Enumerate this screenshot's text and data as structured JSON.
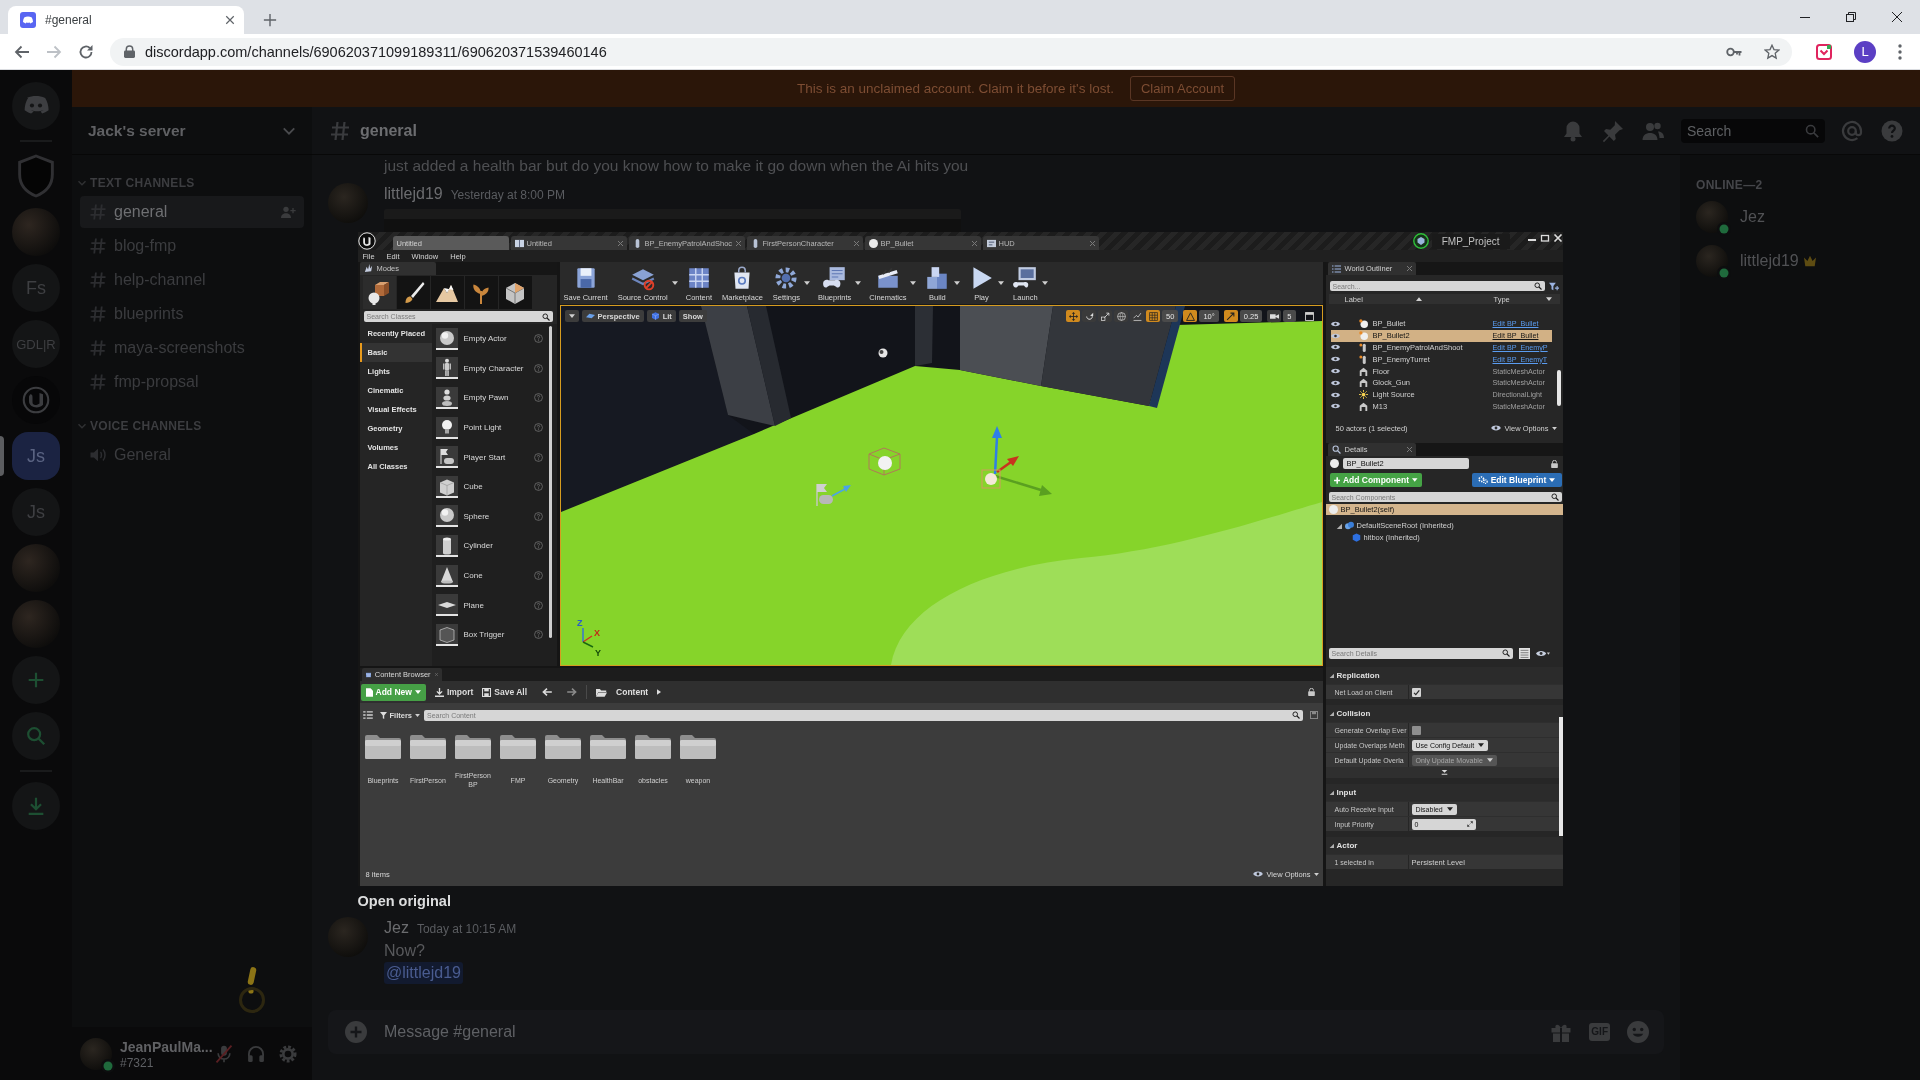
{
  "browser": {
    "tab_title": "#general",
    "url": "discordapp.com/channels/690620371099189311/690620371539460146",
    "profile_initial": "L"
  },
  "discord": {
    "banner": {
      "text": "This is an unclaimed account. Claim it before it's lost.",
      "button": "Claim Account"
    },
    "servers": [
      {
        "kind": "home",
        "selected": false
      },
      {
        "kind": "shield",
        "selected": false
      },
      {
        "kind": "photo",
        "selected": false
      },
      {
        "kind": "text",
        "label": "Fs",
        "selected": false
      },
      {
        "kind": "text",
        "label": "GDL|R",
        "selected": false
      },
      {
        "kind": "engine",
        "selected": false
      },
      {
        "kind": "text",
        "label": "Js",
        "selected": true
      },
      {
        "kind": "text",
        "label": "Js",
        "selected": false
      },
      {
        "kind": "photo",
        "selected": false
      },
      {
        "kind": "photo",
        "selected": false
      },
      {
        "kind": "add",
        "selected": false
      },
      {
        "kind": "explore",
        "selected": false
      },
      {
        "kind": "download",
        "selected": false
      }
    ],
    "server_name": "Jack's server",
    "channel_groups": [
      {
        "title": "TEXT CHANNELS",
        "kind": "text",
        "channels": [
          {
            "name": "general",
            "selected": true
          },
          {
            "name": "blog-fmp",
            "selected": false
          },
          {
            "name": "help-channel",
            "selected": false
          },
          {
            "name": "blueprints",
            "selected": false
          },
          {
            "name": "maya-screenshots",
            "selected": false
          },
          {
            "name": "fmp-propsal",
            "selected": false
          }
        ]
      },
      {
        "title": "VOICE CHANNELS",
        "kind": "voice",
        "channels": [
          {
            "name": "General",
            "selected": false
          }
        ]
      }
    ],
    "user": {
      "name": "JeanPaulMa...",
      "tag": "#7321",
      "mic_muted": true
    },
    "chat": {
      "channel": "general",
      "search_placeholder": "Search",
      "messages": [
        {
          "kind": "continuation",
          "text": "just added a health bar but do you know how to make it go down when the Ai hits you"
        },
        {
          "kind": "group",
          "author": "littlejd19",
          "time": "Yesterday at 8:00 PM",
          "image": true
        },
        {
          "kind": "group",
          "author": "Jez",
          "time": "Today at 10:15 AM",
          "text": "Now?",
          "mention": "@littlejd19",
          "image": false
        }
      ],
      "input_placeholder": "Message #general",
      "gif_label": "GIF"
    },
    "members": {
      "heading": "ONLINE—2",
      "list": [
        {
          "name": "Jez",
          "owner": false
        },
        {
          "name": "littlejd19",
          "owner": true
        }
      ]
    }
  },
  "lightbox": {
    "open_original": "Open original",
    "editor": {
      "tabs": [
        {
          "label": "Untitled",
          "kind": "level",
          "selected": true
        },
        {
          "label": "Untitled",
          "kind": "map",
          "selected": false
        },
        {
          "label": "BP_EnemyPatrolAndShoc",
          "kind": "pawn",
          "selected": false
        },
        {
          "label": "FirstPersonCharacter",
          "kind": "pawn",
          "selected": false
        },
        {
          "label": "BP_Bullet",
          "kind": "sphere",
          "selected": false
        },
        {
          "label": "HUD",
          "kind": "widget",
          "selected": false
        }
      ],
      "project": "FMP_Project",
      "menu": [
        "File",
        "Edit",
        "Window",
        "Help"
      ],
      "modes": {
        "title": "Modes",
        "tools": [
          {
            "kind": "place",
            "selected": true
          },
          {
            "kind": "paint",
            "selected": false
          },
          {
            "kind": "landscape",
            "selected": false
          },
          {
            "kind": "foliage",
            "selected": false
          },
          {
            "kind": "mesh",
            "selected": false
          }
        ],
        "search_placeholder": "Search Classes",
        "categories": [
          {
            "label": "Recently Placed",
            "selected": false
          },
          {
            "label": "Basic",
            "selected": true
          },
          {
            "label": "Lights",
            "selected": false
          },
          {
            "label": "Cinematic",
            "selected": false
          },
          {
            "label": "Visual Effects",
            "selected": false
          },
          {
            "label": "Geometry",
            "selected": false
          },
          {
            "label": "Volumes",
            "selected": false
          },
          {
            "label": "All Classes",
            "selected": false
          }
        ],
        "items": [
          {
            "label": "Empty Actor",
            "kind": "sphere"
          },
          {
            "label": "Empty Character",
            "kind": "figure"
          },
          {
            "label": "Empty Pawn",
            "kind": "pawn"
          },
          {
            "label": "Point Light",
            "kind": "bulb"
          },
          {
            "label": "Player Start",
            "kind": "start"
          },
          {
            "label": "Cube",
            "kind": "cube"
          },
          {
            "label": "Sphere",
            "kind": "sphere"
          },
          {
            "label": "Cylinder",
            "kind": "cylinder"
          },
          {
            "label": "Cone",
            "kind": "cone"
          },
          {
            "label": "Plane",
            "kind": "plane"
          },
          {
            "label": "Box Trigger",
            "kind": "box"
          }
        ]
      },
      "toolbar": [
        {
          "label": "Save Current",
          "kind": "save",
          "dropdown": false
        },
        {
          "label": "Source Control",
          "kind": "source",
          "dropdown": true
        },
        {
          "label": "Content",
          "kind": "content",
          "dropdown": false
        },
        {
          "label": "Marketplace",
          "kind": "market",
          "dropdown": false
        },
        {
          "label": "Settings",
          "kind": "settings",
          "dropdown": true
        },
        {
          "label": "Blueprints",
          "kind": "blueprints",
          "dropdown": true
        },
        {
          "label": "Cinematics",
          "kind": "cinematics",
          "dropdown": true
        },
        {
          "label": "Build",
          "kind": "build",
          "dropdown": true
        },
        {
          "label": "Play",
          "kind": "play",
          "dropdown": true
        },
        {
          "label": "Launch",
          "kind": "launch",
          "dropdown": true
        }
      ],
      "viewport": {
        "buttons": [
          {
            "label": "Perspective",
            "kind": "perspective"
          },
          {
            "label": "Lit",
            "kind": "lit"
          },
          {
            "label": "Show",
            "kind": "plain"
          }
        ],
        "transform_modes": [
          {
            "kind": "move",
            "selected": true
          },
          {
            "kind": "rotate",
            "selected": false
          },
          {
            "kind": "scale",
            "selected": false
          }
        ],
        "snaps": [
          {
            "kind": "grid",
            "value": "50",
            "on": true
          },
          {
            "kind": "angle",
            "value": "10°",
            "on": true
          },
          {
            "kind": "scale",
            "value": "0.25",
            "on": true
          },
          {
            "kind": "speed",
            "value": "5",
            "on": false
          }
        ],
        "axes": [
          "Z",
          "X",
          "Y"
        ]
      },
      "outliner": {
        "title": "World Outliner",
        "search_placeholder": "Search...",
        "columns": [
          "Label",
          "Type"
        ],
        "rows": [
          {
            "label": "BP_Bullet",
            "kind": "sphere",
            "type": "Edit BP_Bullet",
            "link": true,
            "selected": false
          },
          {
            "label": "BP_Bullet2",
            "kind": "sphere",
            "type": "Edit BP_Bullet",
            "link": true,
            "selected": true
          },
          {
            "label": "BP_EnemyPatrolAndShoot",
            "kind": "pawn",
            "type": "Edit BP_EnemyP",
            "link": true,
            "selected": false
          },
          {
            "label": "BP_EnemyTurret",
            "kind": "pawn",
            "type": "Edit BP_EnemyT",
            "link": true,
            "selected": false
          },
          {
            "label": "Floor",
            "kind": "mesh",
            "type": "StaticMeshActor",
            "link": false,
            "selected": false
          },
          {
            "label": "Glock_Gun",
            "kind": "mesh",
            "type": "StaticMeshActor",
            "link": false,
            "selected": false
          },
          {
            "label": "Light Source",
            "kind": "light",
            "type": "DirectionalLight",
            "link": false,
            "selected": false
          },
          {
            "label": "M13",
            "kind": "mesh",
            "type": "StaticMeshActor",
            "link": false,
            "selected": false
          }
        ],
        "summary": "50 actors (1 selected)",
        "view_options": "View Options"
      },
      "details": {
        "title": "Details",
        "actor_name": "BP_Bullet2",
        "add_component": "Add Component",
        "edit_blueprint": "Edit Blueprint",
        "components_search": {
          "placeholder": "Search Components"
        },
        "components": [
          {
            "label": "BP_Bullet2(self)",
            "kind": "sphere",
            "selected": true,
            "children": [
              {
                "label": "DefaultSceneRoot (Inherited)",
                "kind": "scene",
                "selected": false,
                "expanded": true,
                "children": [
                  {
                    "label": "hitbox (Inherited)",
                    "kind": "box",
                    "selected": false
                  }
                ]
              }
            ]
          }
        ],
        "details_search": {
          "placeholder": "Search Details"
        },
        "sections": [
          {
            "title": "Replication",
            "advanced": false,
            "rows": [
              {
                "label": "Net Load on Client",
                "kind": "checkbox",
                "checked": true
              }
            ]
          },
          {
            "title": "Collision",
            "advanced": true,
            "rows": [
              {
                "label": "Generate Overlap Ever",
                "kind": "checkbox",
                "checked": false
              },
              {
                "label": "Update Overlaps Meth",
                "kind": "dropdown",
                "value": "Use Config Default",
                "disabled": false
              },
              {
                "label": "Default Update Overla",
                "kind": "dropdown",
                "value": "Only Update Movable",
                "disabled": true
              }
            ]
          },
          {
            "title": "Input",
            "advanced": false,
            "rows": [
              {
                "label": "Auto Receive Input",
                "kind": "dropdown",
                "value": "Disabled",
                "disabled": false
              },
              {
                "label": "Input Priority",
                "kind": "number",
                "value": "0"
              }
            ]
          },
          {
            "title": "Actor",
            "advanced": false,
            "rows": [
              {
                "label": "1 selected in",
                "kind": "text",
                "value": "Persistent Level"
              }
            ]
          }
        ]
      },
      "content": {
        "title": "Content Browser",
        "add_new": "Add New",
        "import": "Import",
        "save_all": "Save All",
        "path": "Content",
        "filters": "Filters",
        "search_placeholder": "Search Content",
        "folders": [
          "Blueprints",
          "FirstPerson",
          "FirstPerson BP",
          "FMP",
          "Geometry",
          "HealthBar",
          "obstacles",
          "weapon"
        ],
        "count": "8 items",
        "view_options": "View Options"
      }
    }
  }
}
